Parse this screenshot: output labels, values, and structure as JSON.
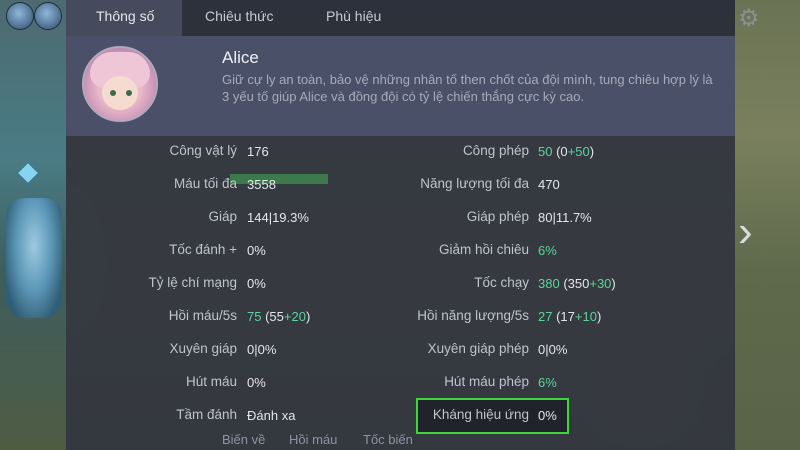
{
  "tabs": [
    {
      "label": "Thông số",
      "active": true
    },
    {
      "label": "Chiêu thức",
      "active": false
    },
    {
      "label": "Phù hiệu",
      "active": false
    }
  ],
  "hero": {
    "name": "Alice",
    "description": "Giữ cự ly an toàn, bảo vệ những nhân tố then chốt của đội mình, tung chiêu hợp lý là 3 yếu tố giúp Alice và đồng đội có tỷ lệ chiến thắng cực kỳ cao."
  },
  "stats_left": [
    {
      "label": "Công vật lý",
      "value": "176"
    },
    {
      "label": "Máu tối đa",
      "value": "3558",
      "bar_fill": 1.0
    },
    {
      "label": "Giáp",
      "value": "144|19.3%"
    },
    {
      "label": "Tốc đánh +",
      "value": "0%"
    },
    {
      "label": "Tỷ lệ chí mạng",
      "value": "0%"
    },
    {
      "label": "Hồi máu/5s",
      "value_main": "75",
      "value_base": "55",
      "value_bonus": "+20"
    },
    {
      "label": "Xuyên giáp",
      "value": "0|0%"
    },
    {
      "label": "Hút máu",
      "value": "0%"
    },
    {
      "label": "Tầm đánh",
      "value": "Đánh xa"
    }
  ],
  "stats_right": [
    {
      "label": "Công phép",
      "value_main": "50",
      "value_base": "0",
      "value_bonus": "+50"
    },
    {
      "label": "Năng lượng tối đa",
      "value": "470"
    },
    {
      "label": "Giáp phép",
      "value": "80|11.7%"
    },
    {
      "label": "Giảm hồi chiêu",
      "value_green": "6%"
    },
    {
      "label": "Tốc chạy",
      "value_main": "380",
      "value_base": "350",
      "value_bonus": "+30"
    },
    {
      "label": "Hồi năng lượng/5s",
      "value_main": "27",
      "value_base": "17",
      "value_bonus": "+10"
    },
    {
      "label": "Xuyên giáp phép",
      "value": "0|0%"
    },
    {
      "label": "Hút máu phép",
      "value_green": "6%"
    },
    {
      "label": "Kháng hiệu ứng",
      "value": "0%",
      "highlighted": true
    }
  ],
  "bottom_hints": [
    "Biến về",
    "Hồi máu",
    "Tốc biến"
  ],
  "colors": {
    "highlight": "#3dd63d",
    "bonus": "#5bd39a",
    "header": "#4a5068"
  }
}
